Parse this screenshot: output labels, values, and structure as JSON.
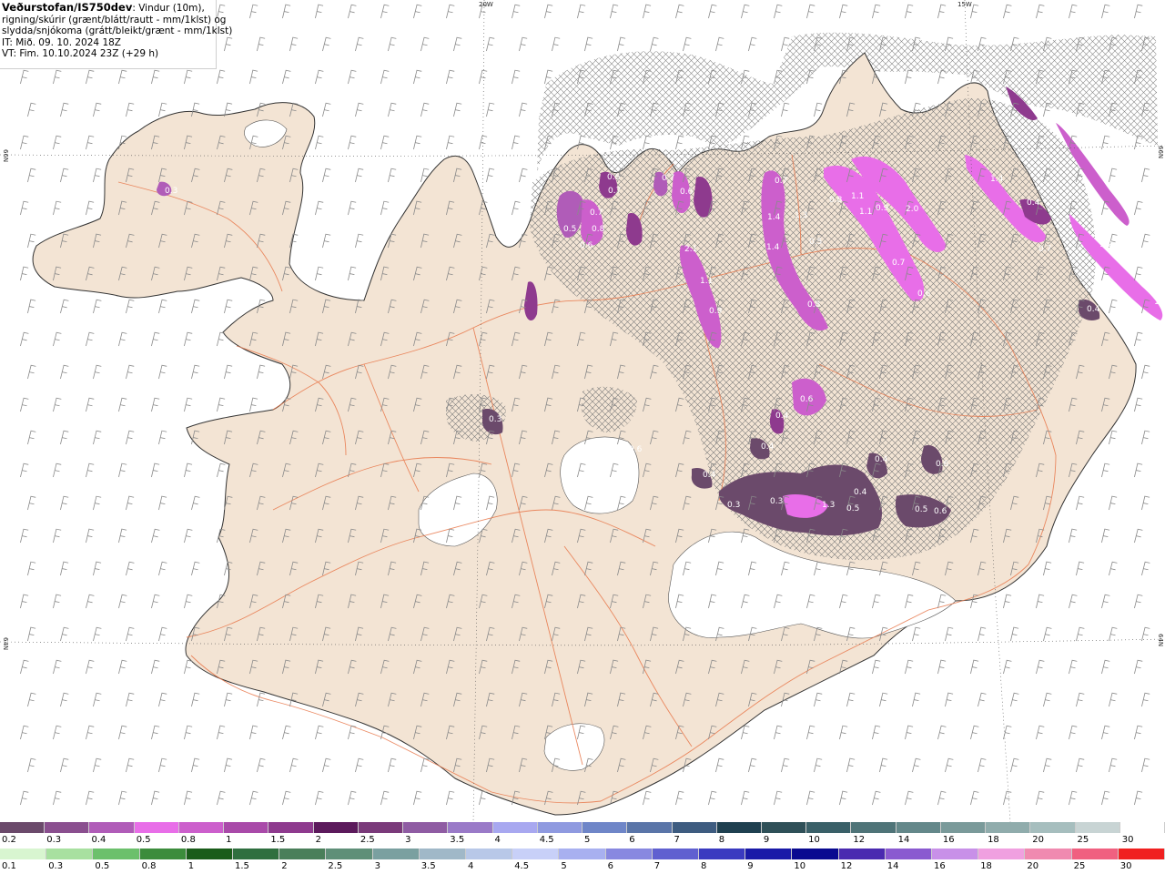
{
  "info": {
    "title_bold": "Veðurstofan/IS750dev",
    "title_rest": ": Vindur (10m),",
    "line2": "rigning/skúrir (grænt/blátt/rautt - mm/1klst) og",
    "line3": "slydda/snjókoma (grátt/bleikt/grænt - mm/1klst)",
    "line4": "IT: Mið. 09. 10. 2024 18Z",
    "line5": "VT: Fim. 10.10.2024 23Z (+29 h)"
  },
  "coords": {
    "top_20w": "20W",
    "top_15w": "15W",
    "left_66n": "66N",
    "right_66n": "66N",
    "left_64n": "64N",
    "right_64n": "64N"
  },
  "colors": {
    "sea": "#ffffff",
    "land": "#f3e4d4",
    "coast": "#333333",
    "roads": "#e8774a",
    "glacier": "#ffffff",
    "wind_barb": "#8a8a8a",
    "hatch": "#777777"
  },
  "legend_top": {
    "labels": [
      "0.2",
      "0.3",
      "0.4",
      "0.5",
      "0.8",
      "1",
      "1.5",
      "2",
      "2.5",
      "3",
      "3.5",
      "4",
      "4.5",
      "5",
      "6",
      "7",
      "8",
      "9",
      "10",
      "12",
      "14",
      "16",
      "18",
      "20",
      "25",
      "30"
    ],
    "colors": [
      "#6b4a6b",
      "#8a4f8f",
      "#b05cb8",
      "#e86ee8",
      "#cc5fcc",
      "#a94aa9",
      "#8e3a8e",
      "#5c1a5c",
      "#7a3a7a",
      "#8f5ca3",
      "#9a7ac8",
      "#a8a8f0",
      "#8f9ae0",
      "#6f86c8",
      "#5a75a8",
      "#3e5c80",
      "#1f4050",
      "#2f5058",
      "#3a6068",
      "#4f7478",
      "#64888a",
      "#7a9a9a",
      "#90acac",
      "#a6bebe",
      "#c8d4d4",
      "#ffffff"
    ]
  },
  "legend_bottom": {
    "labels": [
      "0.1",
      "0.3",
      "0.5",
      "0.8",
      "1",
      "1.5",
      "2",
      "2.5",
      "3",
      "3.5",
      "4",
      "4.5",
      "5",
      "6",
      "7",
      "8",
      "9",
      "10",
      "12",
      "14",
      "16",
      "18",
      "20",
      "25",
      "30"
    ],
    "colors": [
      "#d8f5d0",
      "#a8e0a0",
      "#6cc06c",
      "#3c8c3c",
      "#1a5c1a",
      "#2f6f3f",
      "#4a7f5a",
      "#5f8f78",
      "#7aa0a0",
      "#a0b8c8",
      "#b8c8e8",
      "#c8d0f8",
      "#a8b0f0",
      "#8888e0",
      "#6060d0",
      "#3a3ac0",
      "#1a1aa8",
      "#0a0a90",
      "#4a2ab0",
      "#8a5ad0",
      "#c890e8",
      "#f0a0e0",
      "#f08ab0",
      "#f06080",
      "#f02020"
    ]
  },
  "precip_labels": [
    {
      "text": "0.3"
    },
    {
      "text": "0.7"
    },
    {
      "text": "0.8"
    },
    {
      "text": "0.6"
    },
    {
      "text": "0.5"
    },
    {
      "text": "0.7"
    },
    {
      "text": "0.6"
    },
    {
      "text": "0.7"
    },
    {
      "text": "0.6"
    },
    {
      "text": "2.1"
    },
    {
      "text": "1.1"
    },
    {
      "text": "0.9"
    },
    {
      "text": "0.7"
    },
    {
      "text": "1.4"
    },
    {
      "text": "1.3"
    },
    {
      "text": "1.4"
    },
    {
      "text": "0.5"
    },
    {
      "text": "0.8"
    },
    {
      "text": "0.8"
    },
    {
      "text": "1.1"
    },
    {
      "text": "0.9"
    },
    {
      "text": "2.0"
    },
    {
      "text": "1.1"
    },
    {
      "text": "0.7"
    },
    {
      "text": "0.6"
    },
    {
      "text": "1.4"
    },
    {
      "text": "0.4"
    },
    {
      "text": "0.7"
    },
    {
      "text": "1.2"
    },
    {
      "text": "1.2"
    },
    {
      "text": "0.4"
    },
    {
      "text": "0.3"
    },
    {
      "text": "0.6"
    },
    {
      "text": "0.4"
    },
    {
      "text": "0.4"
    },
    {
      "text": "0.4"
    },
    {
      "text": "0.3"
    },
    {
      "text": "1.3"
    },
    {
      "text": "0.4"
    },
    {
      "text": "0.5"
    },
    {
      "text": "0.5"
    },
    {
      "text": "0.6"
    },
    {
      "text": "0.6"
    },
    {
      "text": "0.4"
    },
    {
      "text": "0.3"
    },
    {
      "text": "0.6"
    }
  ]
}
